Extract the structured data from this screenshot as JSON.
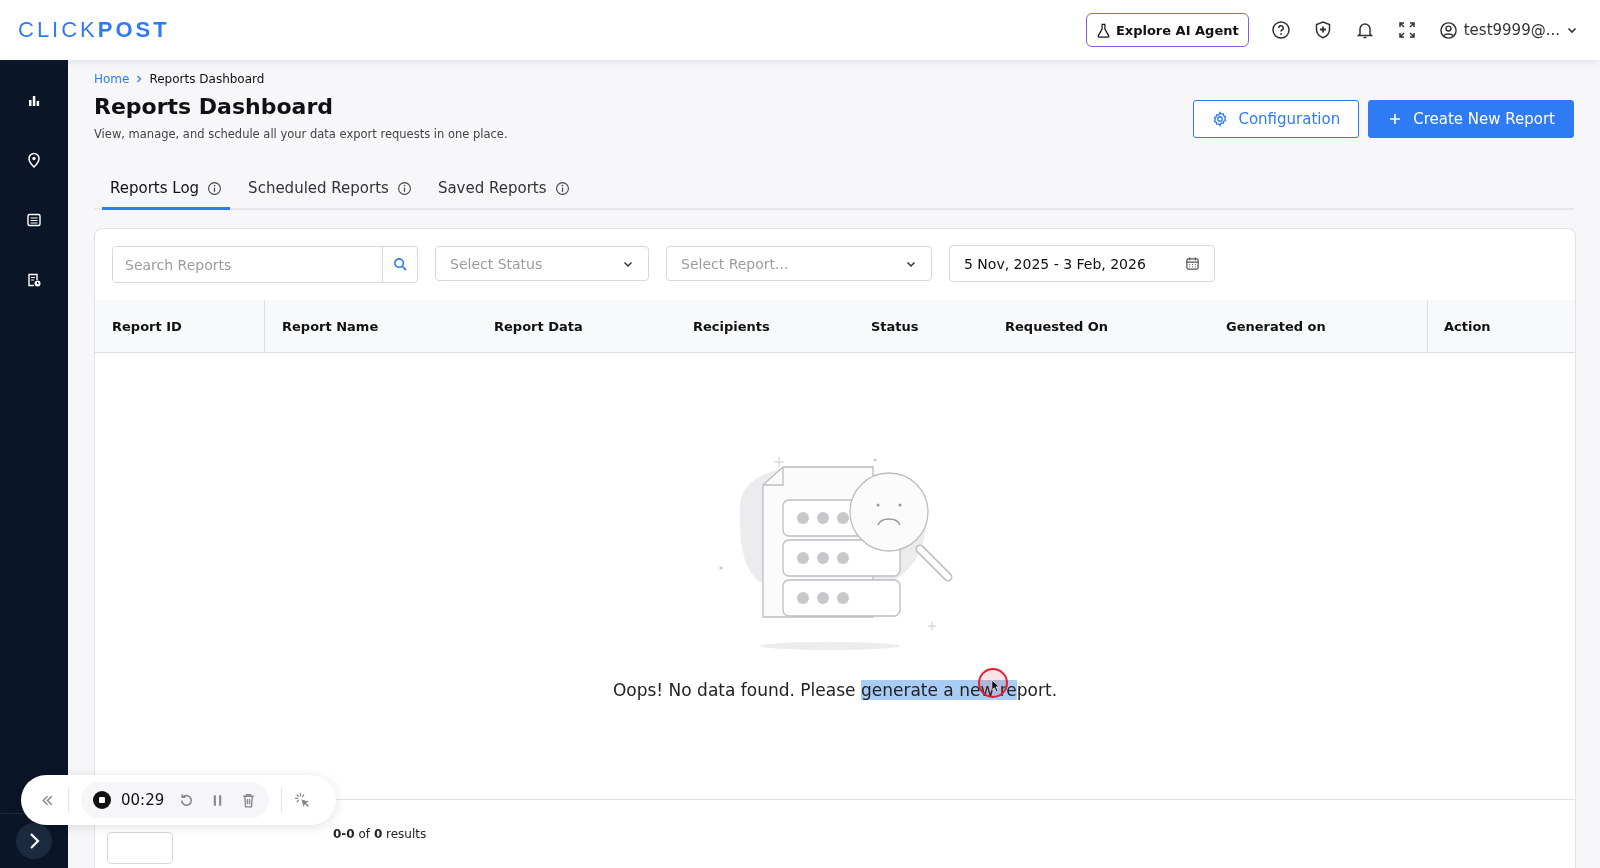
{
  "header": {
    "logo": "CLICK**POST**",
    "ai_button": "Explore AI Agent",
    "user": "test9999@..."
  },
  "sidebar": {
    "items": [
      {
        "kind": "chart"
      },
      {
        "kind": "pin"
      },
      {
        "kind": "list"
      },
      {
        "kind": "report"
      }
    ]
  },
  "breadcrumb": [
    "Home",
    "Reports Dashboard"
  ],
  "page": {
    "title": "Reports Dashboard",
    "subtitle": "View, manage, and schedule all your data export requests in one place."
  },
  "actions": [
    {
      "kind": "outline",
      "label": "Configuration"
    },
    {
      "kind": "primary",
      "label": "Create New Report"
    }
  ],
  "tabs": [
    {
      "label": "Reports Log",
      "selected": true
    },
    {
      "label": "Scheduled Reports",
      "selected": false
    },
    {
      "label": "Saved Reports",
      "selected": false
    }
  ],
  "filters": {
    "search": {
      "placeholder": "Search Reports"
    },
    "status": {
      "placeholder": "Select Status"
    },
    "report": {
      "placeholder": "Select Report..."
    },
    "date_range": {
      "value": "5 Nov, 2025 - 3 Feb, 2026"
    }
  },
  "table": {
    "columns": [
      "Report ID",
      "Report Name",
      "Report Data",
      "Recipients",
      "Status",
      "Requested On",
      "Generated on",
      "Action"
    ]
  },
  "empty_state": {
    "message_start": "Oops! No data found. Please ",
    "message_selected": "generate a new re",
    "message_end": "port."
  },
  "footer": {
    "results": "**0-0** of **0** results"
  },
  "recorder": {
    "time": "00:29"
  }
}
